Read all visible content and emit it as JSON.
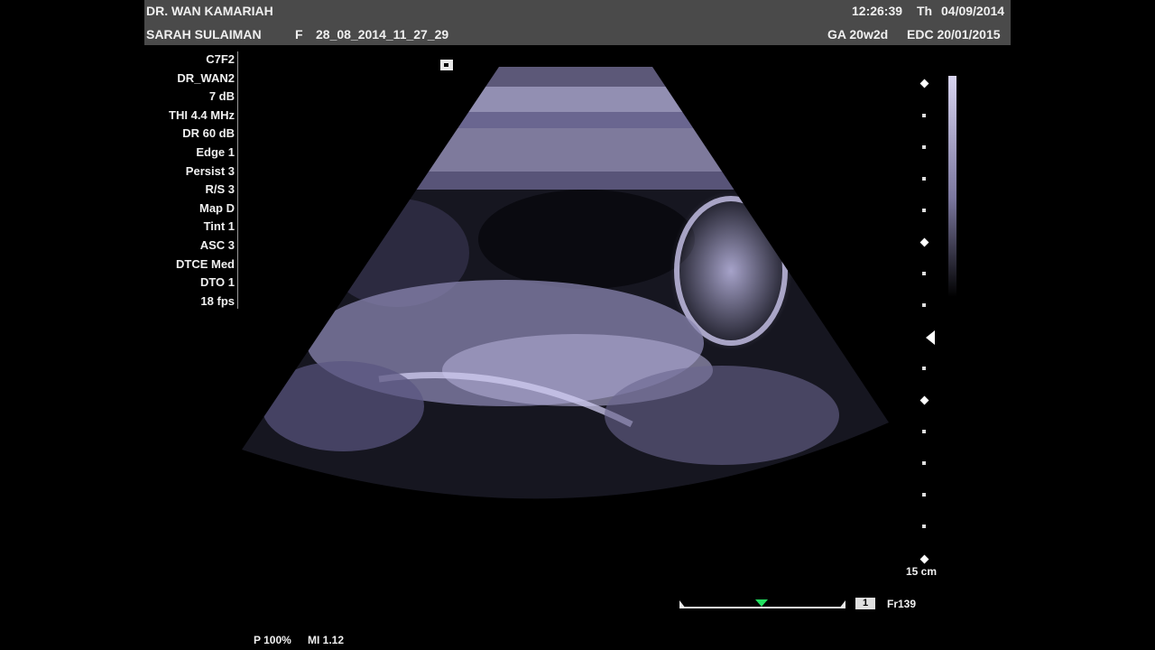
{
  "header": {
    "doctor": "DR. WAN KAMARIAH",
    "time": "12:26:39",
    "day": "Th",
    "date": "04/09/2014",
    "patient": "SARAH SULAIMAN",
    "sex": "F",
    "exam_id": "28_08_2014_11_27_29",
    "ga": "GA 20w2d",
    "edc": "EDC 20/01/2015"
  },
  "params": [
    "C7F2",
    "DR_WAN2",
    "7 dB",
    "THI 4.4 MHz",
    "DR 60 dB",
    "Edge 1",
    "Persist 3",
    "R/S 3",
    "Map D",
    "Tint 1",
    "ASC 3",
    "DTCE Med",
    "DTO 1",
    "18 fps"
  ],
  "depth": "15 cm",
  "cine": {
    "page": "1",
    "frame": "Fr139"
  },
  "footer": {
    "power": "P 100%",
    "mi": "MI 1.12"
  },
  "colors": {
    "header_bg": "#4a4a4a",
    "cine_marker": "#22e060",
    "tint": "#b4b0dc"
  },
  "icons": [
    "orientation-marker-icon",
    "focus-marker-icon",
    "grayscale-bar"
  ]
}
